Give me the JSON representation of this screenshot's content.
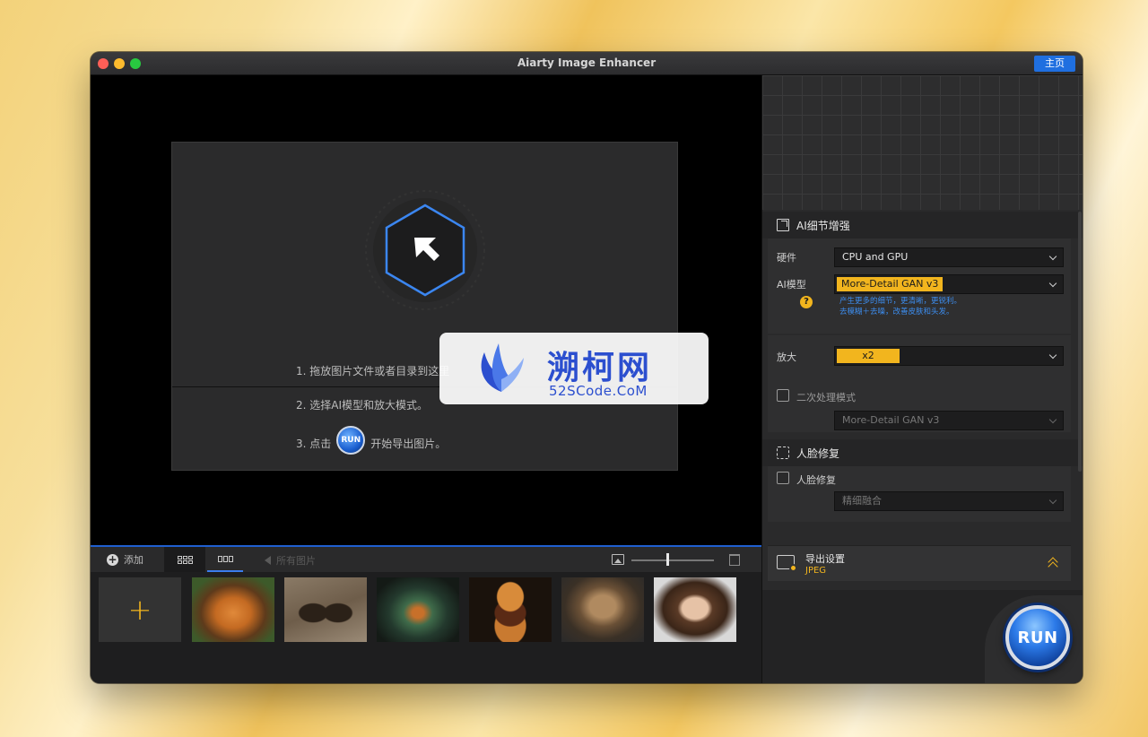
{
  "window": {
    "title": "Aiarty Image Enhancer",
    "home_label": "主页"
  },
  "drop_area": {
    "step1": "1. 拖放图片文件或者目录到这里",
    "step2": "2. 选择AI模型和放大模式。",
    "step3_prefix": "3. 点击",
    "step3_run": "RUN",
    "step3_suffix": "开始导出图片。"
  },
  "strip": {
    "add_label": "添加",
    "all_images_label": "所有图片",
    "zoom_level": 0.42,
    "thumbnails": [
      "tiger",
      "butterfly",
      "terrarium",
      "burger",
      "dog-warrior",
      "portrait"
    ]
  },
  "panel": {
    "enhance_title": "AI细节增强",
    "hardware_label": "硬件",
    "hardware_value": "CPU and GPU",
    "model_label": "AI模型",
    "model_value": "More-Detail GAN v3",
    "help_glyph": "?",
    "model_desc_1": "产生更多的细节，更清晰，更锐利。",
    "model_desc_2": "去模糊＋去噪，改善皮肤和头发。",
    "upscale_label": "放大",
    "upscale_value": "x2",
    "second_pass_label": "二次处理模式",
    "second_pass_model": "More-Detail GAN v3",
    "face_title": "人脸修复",
    "face_check_label": "人脸修复",
    "face_mode": "精细融合",
    "export_title": "导出设置",
    "export_format": "JPEG",
    "run_label": "RUN"
  },
  "watermark": {
    "title": "溯柯网",
    "subtitle": "52SCode.CoM"
  },
  "colors": {
    "accent_blue": "#1f6fe0",
    "accent_yellow": "#f2b51e",
    "desc_blue": "#3d8ef0"
  }
}
